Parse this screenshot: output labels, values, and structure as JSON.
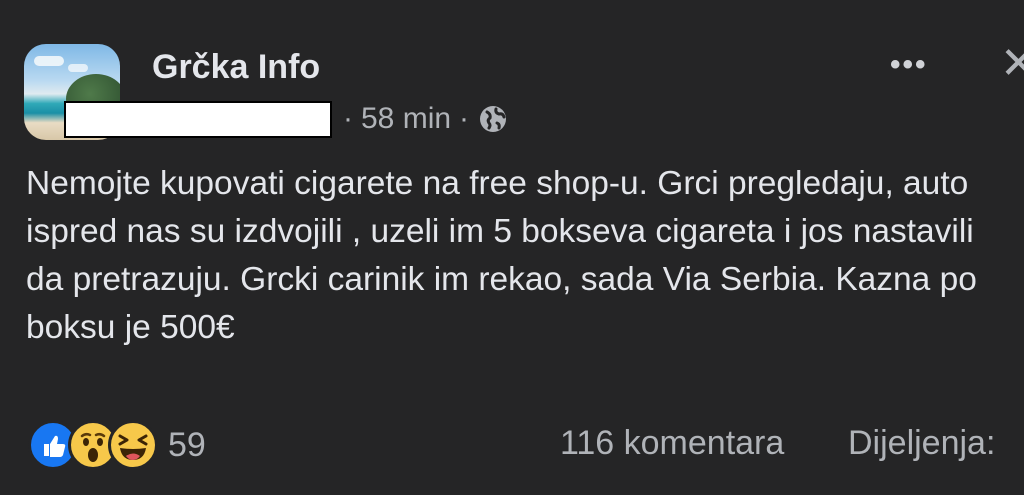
{
  "post": {
    "page_name": "Grčka Info",
    "time": "58 min",
    "separator": "·",
    "text": "Nemojte kupovati cigarete na free shop-u. Grci pregledaju, auto ispred nas su izdvojili , uzeli im 5 bokseva cigareta i jos nastavili da pretrazuju. Grcki carinik im rekao, sada Via Serbia. Kazna po boksu je 500€",
    "icons": {
      "audience": "globe-icon",
      "menu": "more-dots-icon",
      "close": "close-icon"
    }
  },
  "header": {
    "more_label": "•••",
    "close_label": "✕"
  },
  "footer": {
    "reaction_count": "59",
    "reactions": [
      "like",
      "wow",
      "haha"
    ],
    "comments": "116 komentara",
    "shares": "Dijeljenja:"
  },
  "colors": {
    "background": "#252526",
    "text": "#e4e6eb",
    "secondary": "#b0b3b8",
    "like_blue": "#1877f2",
    "emoji_yellow": "#f7c84a"
  }
}
